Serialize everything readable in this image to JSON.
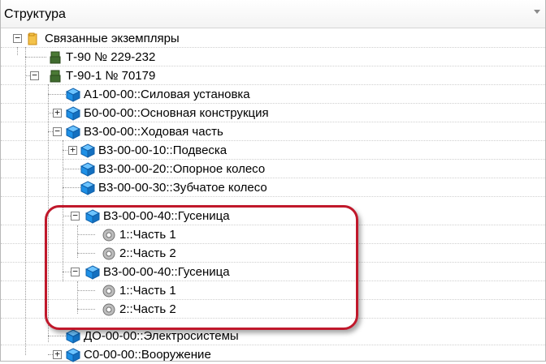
{
  "header": {
    "title": "Структура"
  },
  "tree": {
    "root": "Связанные экземпляры",
    "t90": "Т-90 № 229-232",
    "t90_1": "Т-90-1  № 70179",
    "a1": "А1-00-00::Силовая установка",
    "b0": "Б0-00-00::Основная конструкция",
    "b3": "В3-00-00::Ходовая часть",
    "b3_10": "В3-00-00-10::Подвеска",
    "b3_20": "В3-00-00-20::Опорное колесо",
    "b3_30": "В3-00-00-30::Зубчатое колесо",
    "b3_40a": "В3-00-00-40::Гусеница",
    "part1a": "1::Часть 1",
    "part2a": "2::Часть 2",
    "b3_40b": "В3-00-00-40::Гусеница",
    "part1b": "1::Часть 1",
    "part2b": "2::Часть 2",
    "do": "ДО-00-00::Электросистемы",
    "c0": "С0-00-00::Вооружение"
  },
  "colors": {
    "highlight": "#c0182b",
    "cube": "#1e90e6",
    "folder": "#e8a21c",
    "tank": "#3f6b2e"
  },
  "icons": {
    "folder": "folder-icon",
    "tank": "tank-icon",
    "cube": "cube-icon",
    "gear": "gear-icon"
  }
}
